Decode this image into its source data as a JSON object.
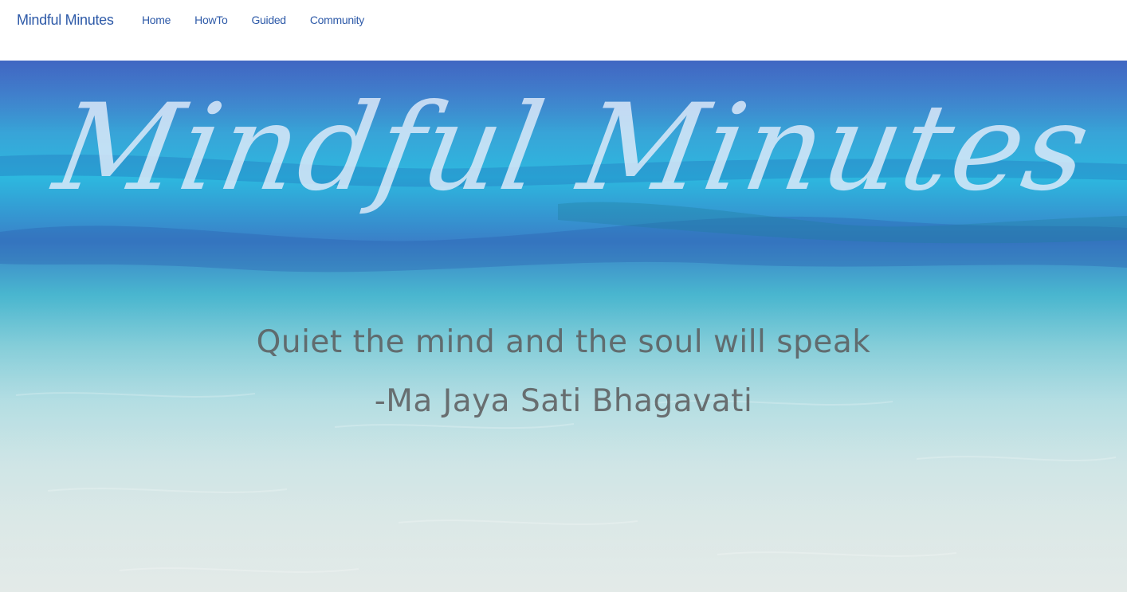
{
  "nav": {
    "brand": "Mindful Minutes",
    "links": [
      {
        "label": "Home"
      },
      {
        "label": "HowTo"
      },
      {
        "label": "Guided"
      },
      {
        "label": "Community"
      }
    ]
  },
  "hero": {
    "title": "Mindful Minutes",
    "quote": "Quiet the mind and the soul will speak",
    "attribution": "-Ma Jaya Sati Bhagavati"
  },
  "colors": {
    "nav_text": "#2e5aa8",
    "title_text": "#e1ebfa",
    "quote_text": "#5a5a5c"
  }
}
